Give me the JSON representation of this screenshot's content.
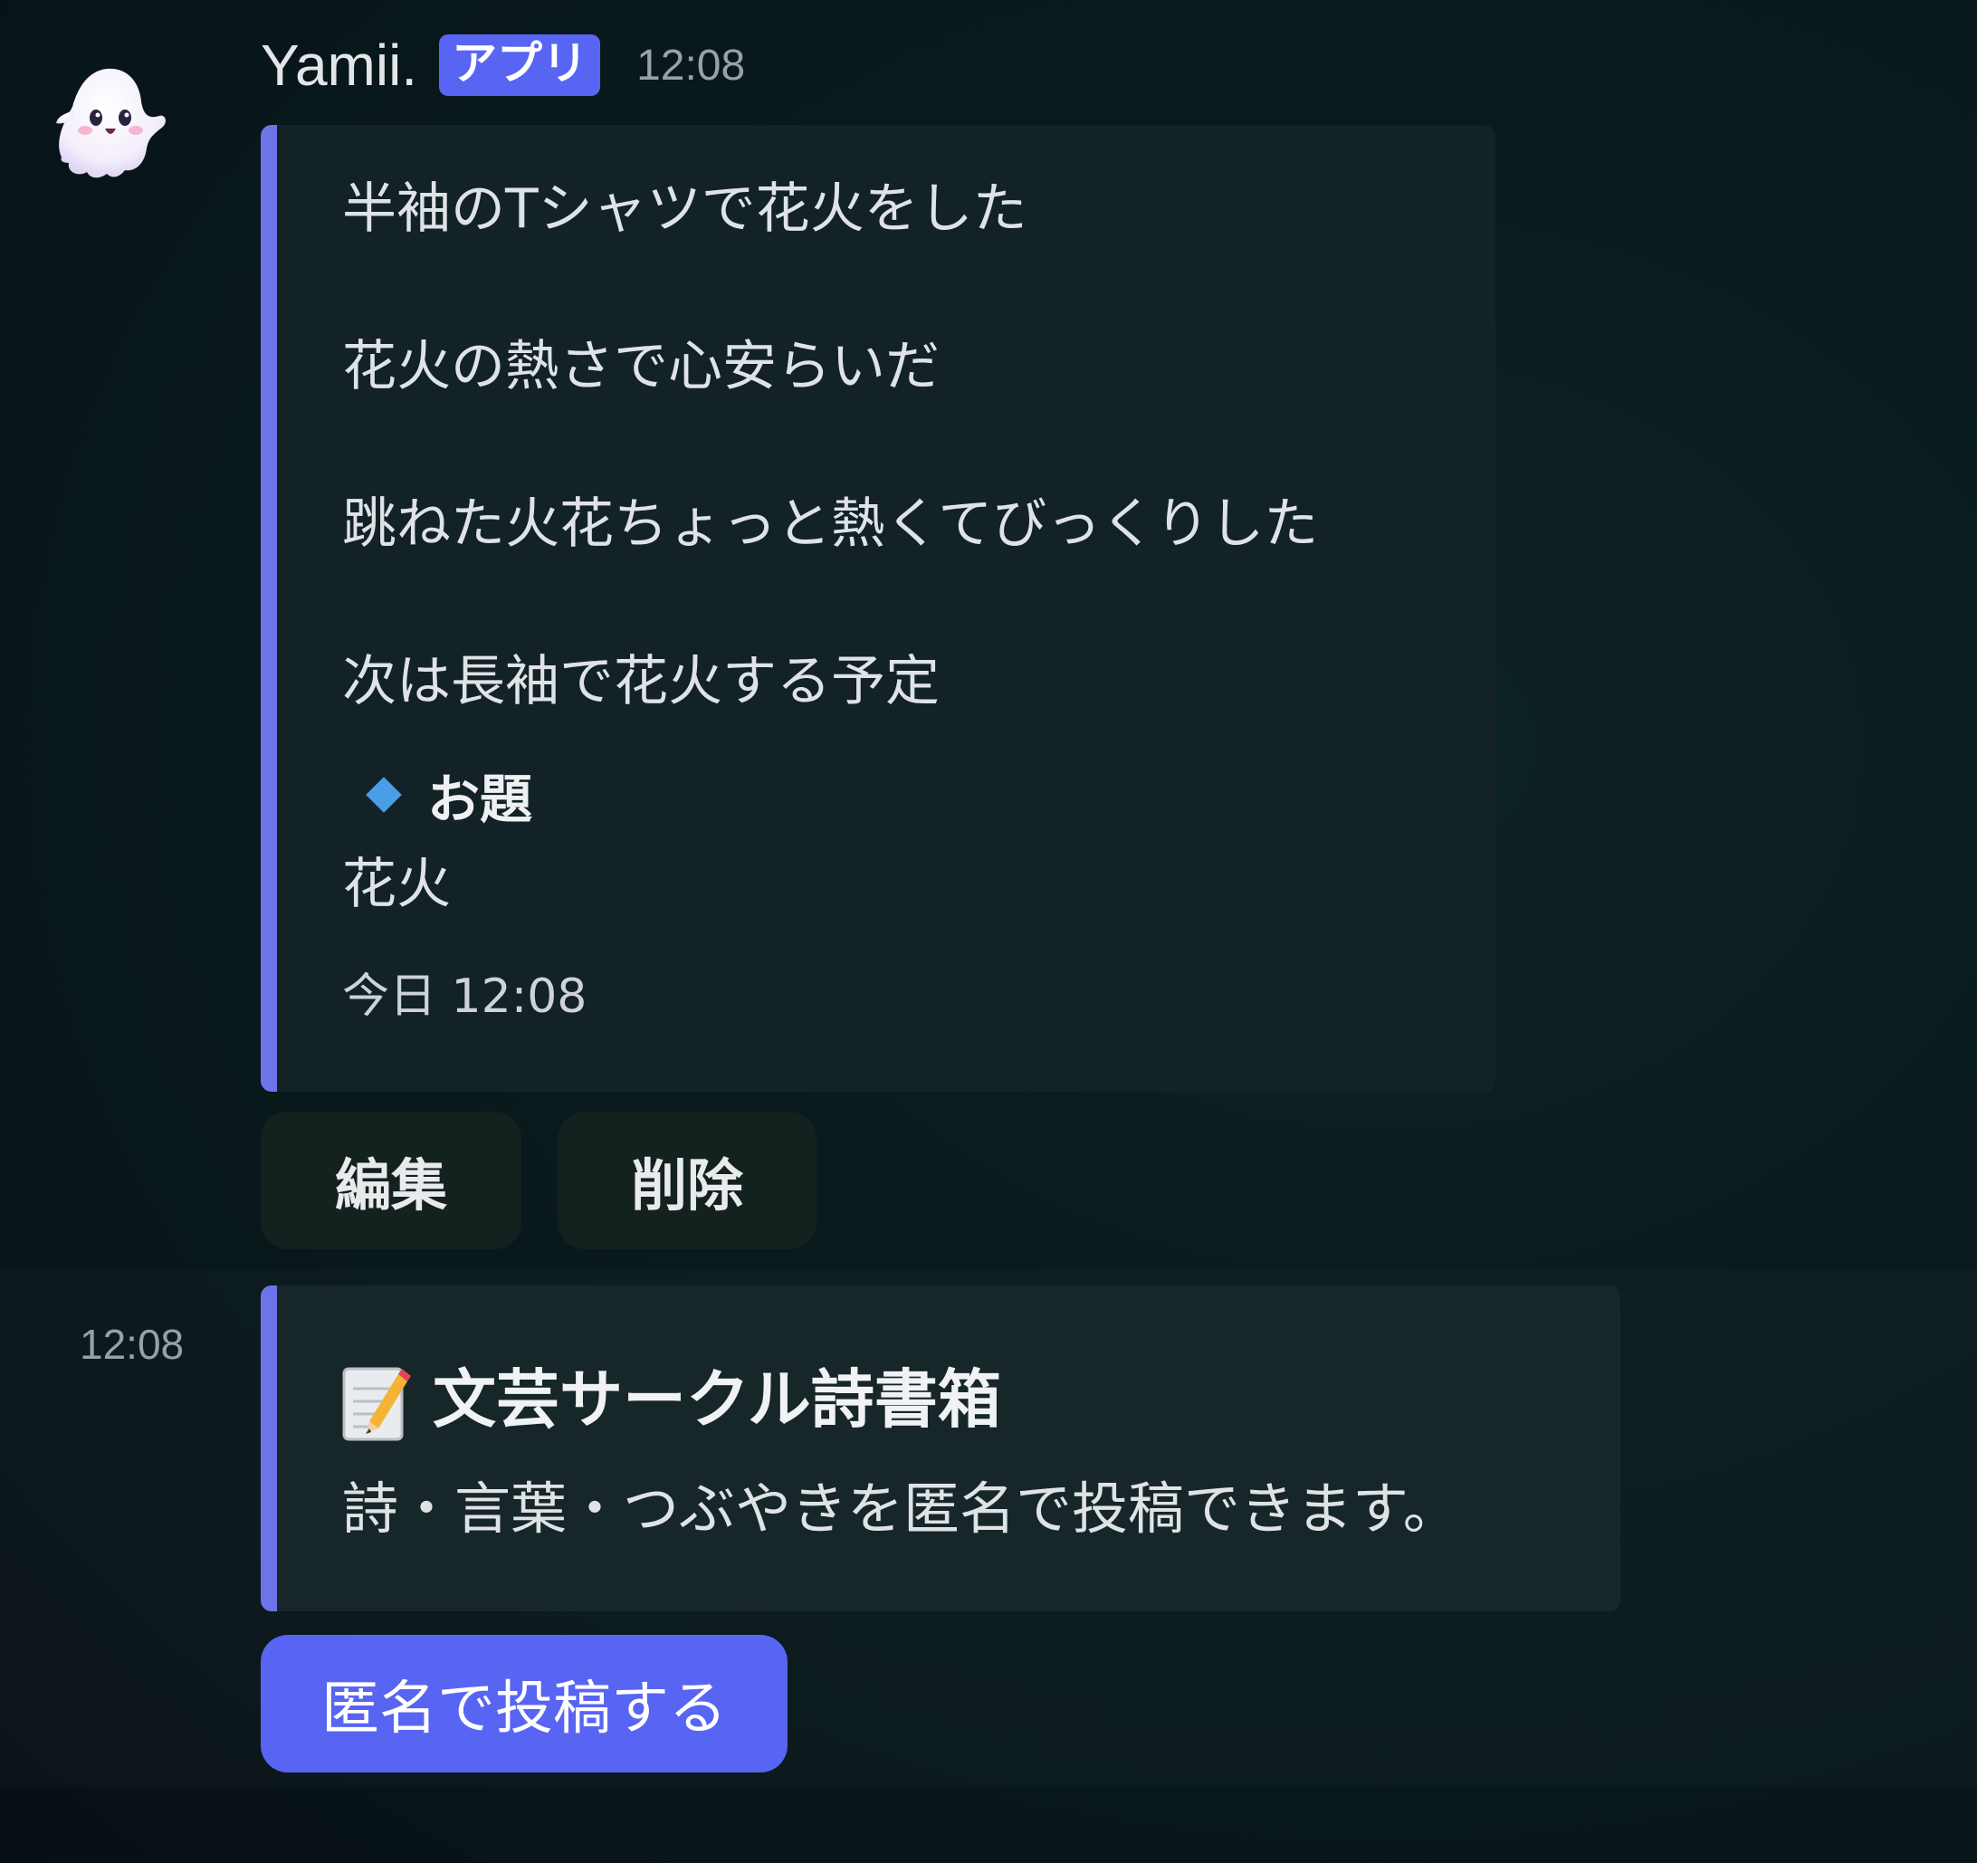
{
  "message": {
    "username": "Yamii.",
    "badge": "アプリ",
    "time": "12:08",
    "avatar_icon": "ghost-avatar-icon",
    "embed": {
      "accent_color": "#6d74e8",
      "poem_lines": [
        "半袖のTシャツで花火をした",
        "花火の熱さで心安らいだ",
        "跳ねた火花ちょっと熱くてびっくりした",
        "次は長袖で花火する予定"
      ],
      "field_icon": "blue-diamond-icon",
      "field_name": "お題",
      "field_value": "花火",
      "footer_timestamp": "今日 12:08"
    },
    "buttons": {
      "edit": "編集",
      "delete": "削除"
    }
  },
  "followup": {
    "time": "12:08",
    "embed": {
      "title_icon": "memo-icon",
      "title": "文芸サークル詩書箱",
      "description": "詩・言葉・つぶやきを匿名で投稿できます。"
    },
    "button": "匿名で投稿する"
  },
  "colors": {
    "brand": "#5865f2",
    "embed_accent": "#6d74e8",
    "background": "#0a1a1c"
  }
}
